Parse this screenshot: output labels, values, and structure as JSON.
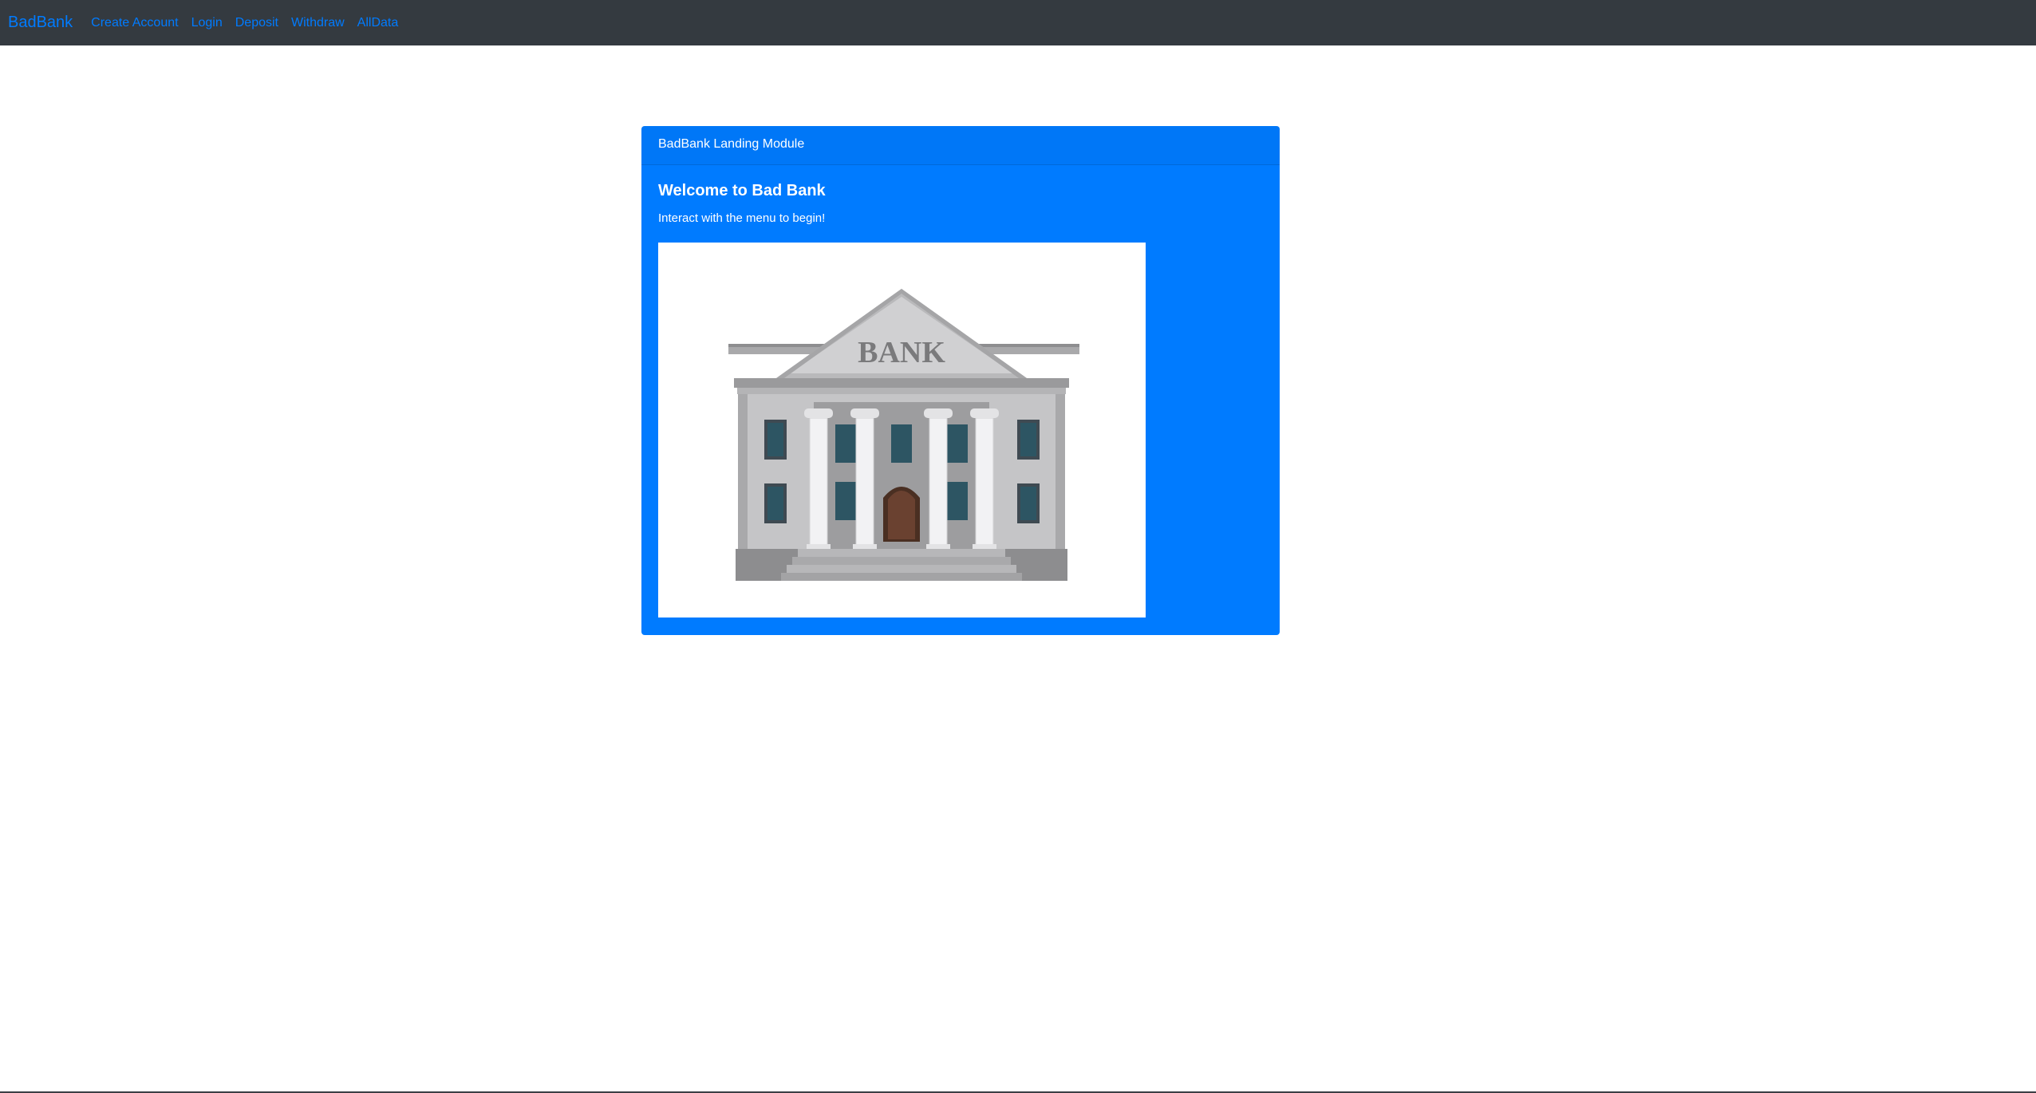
{
  "navbar": {
    "brand": "BadBank",
    "links": [
      "Create Account",
      "Login",
      "Deposit",
      "Withdraw",
      "AllData"
    ]
  },
  "card": {
    "header": "BadBank Landing Module",
    "title": "Welcome to Bad Bank",
    "text": "Interact with the menu to begin!",
    "image": {
      "icon": "bank-building-illustration",
      "sign_text": "BANK"
    }
  },
  "colors": {
    "navbar_bg": "#343a40",
    "link": "#007bff",
    "card_bg": "#007bff"
  }
}
